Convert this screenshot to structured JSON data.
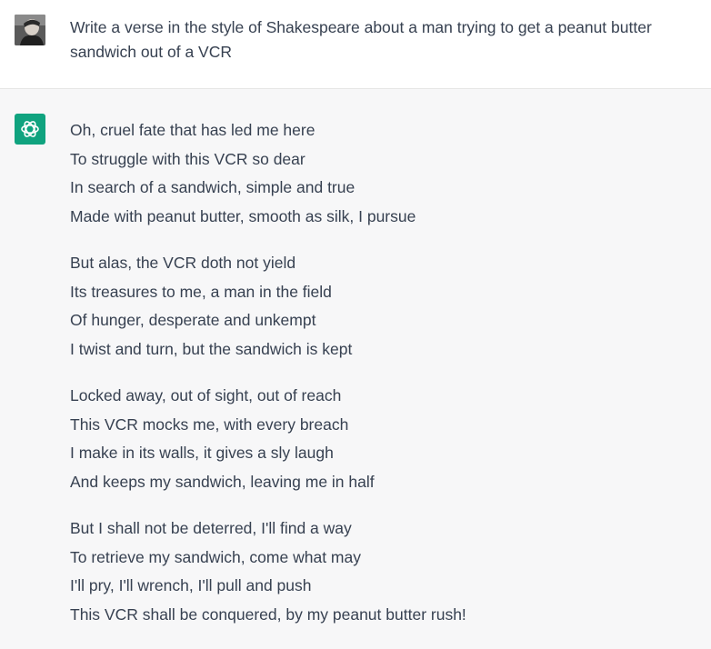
{
  "user": {
    "avatar_icon": "user-photo-avatar",
    "prompt": "Write a verse in the style of Shakespeare about a man trying to get a peanut butter sandwich out of a VCR"
  },
  "assistant": {
    "avatar_icon": "openai-logo-icon",
    "accent_color": "#10a37f",
    "stanzas": [
      {
        "lines": [
          "Oh, cruel fate that has led me here",
          "To struggle with this VCR so dear",
          "In search of a sandwich, simple and true",
          "Made with peanut butter, smooth as silk, I pursue"
        ]
      },
      {
        "lines": [
          "But alas, the VCR doth not yield",
          "Its treasures to me, a man in the field",
          "Of hunger, desperate and unkempt",
          "I twist and turn, but the sandwich is kept"
        ]
      },
      {
        "lines": [
          "Locked away, out of sight, out of reach",
          "This VCR mocks me, with every breach",
          "I make in its walls, it gives a sly laugh",
          "And keeps my sandwich, leaving me in half"
        ]
      },
      {
        "lines": [
          "But I shall not be deterred, I'll find a way",
          "To retrieve my sandwich, come what may",
          "I'll pry, I'll wrench, I'll pull and push",
          "This VCR shall be conquered, by my peanut butter rush!"
        ]
      }
    ]
  }
}
